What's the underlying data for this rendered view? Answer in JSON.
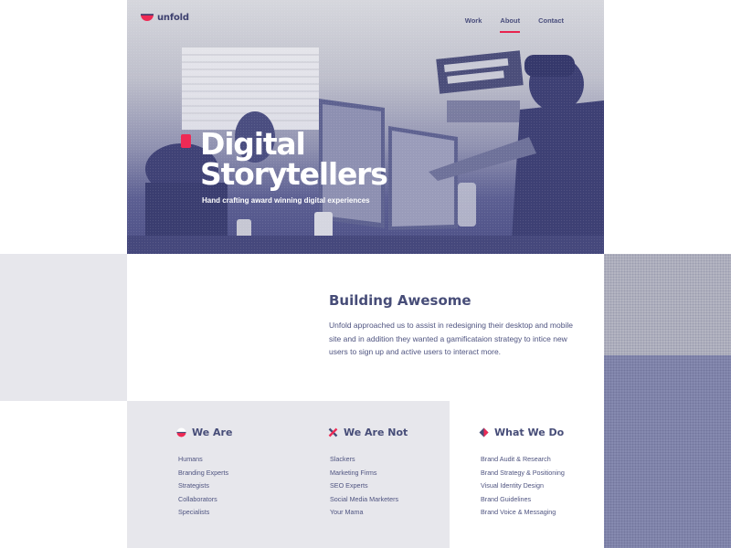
{
  "brand": {
    "name": "unfold",
    "accent_color": "#ee2a55",
    "primary_color": "#474d78"
  },
  "nav": {
    "items": [
      {
        "label": "Work",
        "active": false
      },
      {
        "label": "About",
        "active": true
      },
      {
        "label": "Contact",
        "active": false
      }
    ]
  },
  "hero": {
    "title_line1": "Digital",
    "title_line2": "Storytellers",
    "subtitle": "Hand crafting award winning digital experiences"
  },
  "intro": {
    "title": "Building Awesome",
    "body": "Unfold approached us to assist in redesigning their desktop and mobile site and in addition they wanted a gamificataion strategy to intice new users to sign up and active users to interact more."
  },
  "columns": [
    {
      "title": "We Are",
      "icon": "bowl-icon",
      "items": [
        "Humans",
        "Branding Experts",
        "Strategists",
        "Collaborators",
        "Specialists"
      ]
    },
    {
      "title": "We Are Not",
      "icon": "x-mark-icon",
      "items": [
        "Slackers",
        "Marketing Firms",
        "SEO Experts",
        "Social Media Marketers",
        "Your Mama"
      ]
    },
    {
      "title": "What We Do",
      "icon": "diamond-icon",
      "items": [
        "Brand Audit & Research",
        "Brand Strategy & Positioning",
        "Visual Identity Design",
        "Brand Guidelines",
        "Brand Voice & Messaging"
      ]
    }
  ]
}
